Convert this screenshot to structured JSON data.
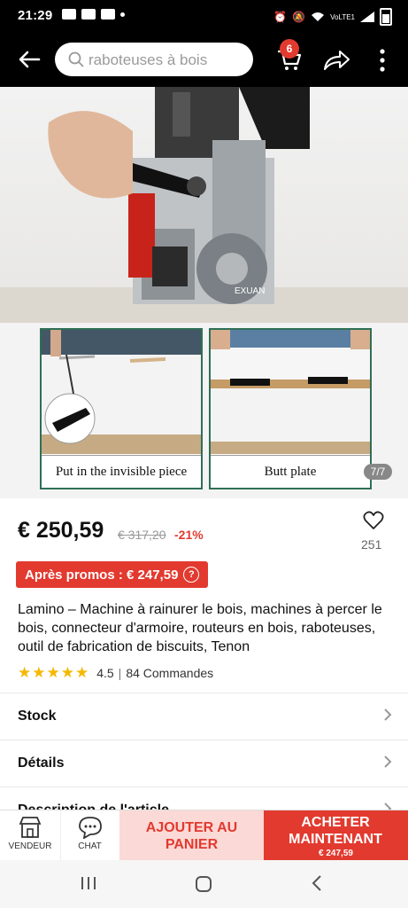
{
  "status": {
    "time": "21:29",
    "network": "VoLTE1"
  },
  "search": {
    "placeholder": "raboteuses à bois"
  },
  "cart": {
    "badge": "6"
  },
  "gallery": {
    "caption_left": "Put in the invisible piece",
    "caption_right": "Butt plate",
    "counter": "7/7",
    "brand": "EXUAN"
  },
  "price": {
    "current": "€ 250,59",
    "original": "€ 317,20",
    "discount": "-21%",
    "likes": "251",
    "promo": "Après promos : € 247,59",
    "promo_help": "?"
  },
  "product": {
    "title": "Lamino – Machine à rainurer le bois, machines à percer le bois, connecteur d'armoire, routeurs en bois, raboteuses, outil de fabrication de biscuits, Tenon",
    "stars": "★★★★★",
    "rating": "4.5",
    "orders": "84 Commandes"
  },
  "sections": {
    "stock": "Stock",
    "details": "Détails",
    "description": "Description de l'article"
  },
  "actions": {
    "seller": "VENDEUR",
    "chat": "CHAT",
    "add_to_cart": "AJOUTER AU PANIER",
    "buy_now": "ACHETER MAINTENANT",
    "buy_price": "€ 247,59"
  },
  "colors": {
    "accent": "#e23a2f",
    "accent_light": "#fbd9d6",
    "frame": "#2f6f55",
    "star": "#f5b700"
  }
}
